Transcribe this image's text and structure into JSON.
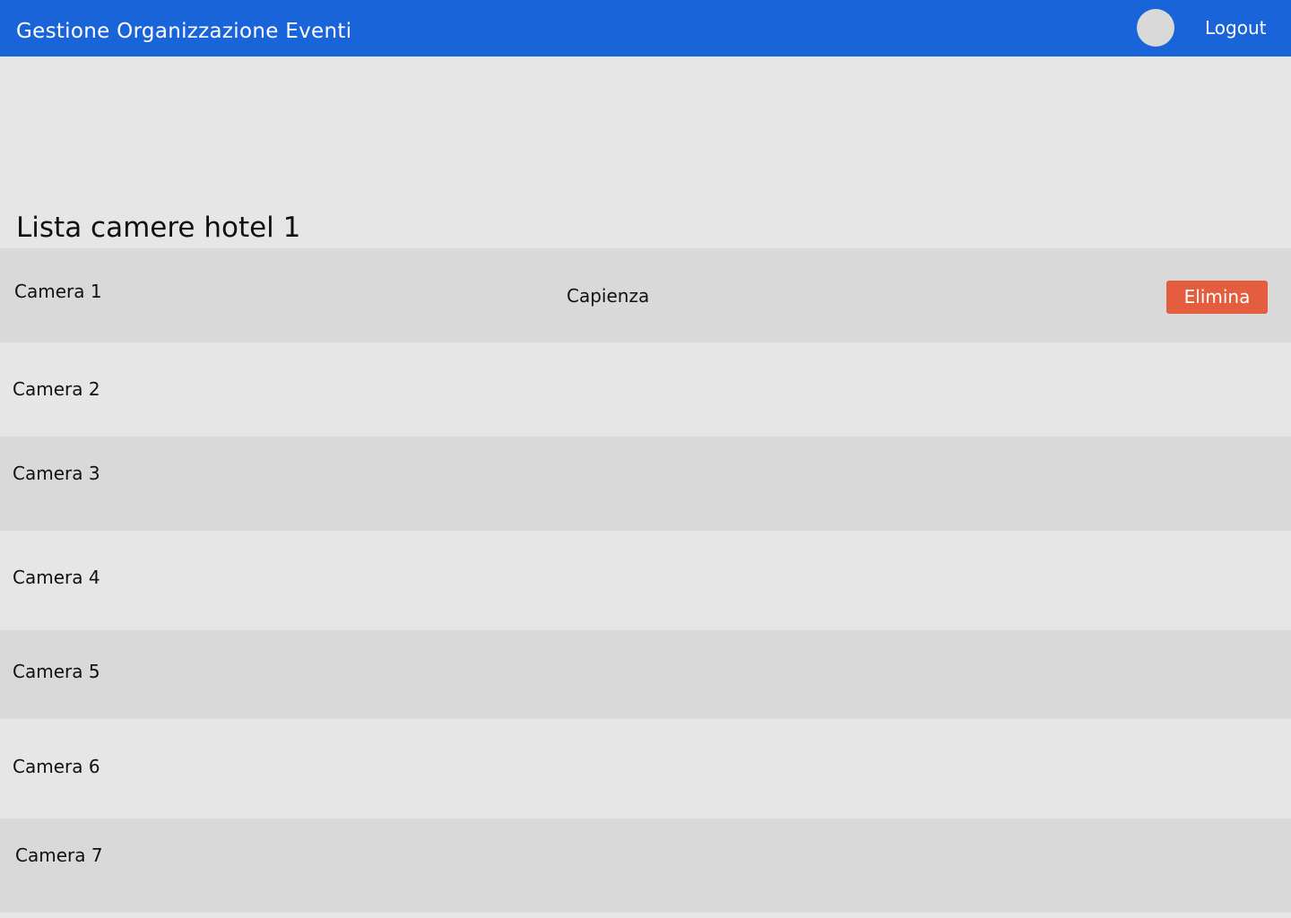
{
  "header": {
    "app_title": "Gestione Organizzazione Eventi",
    "logout_label": "Logout",
    "avatar_icon": "user-avatar",
    "background_color": "#1a64d9"
  },
  "page": {
    "title": "Lista camere hotel 1"
  },
  "rooms": [
    {
      "name": "Camera 1",
      "capacity_label": "Capienza",
      "delete_label": "Elimina"
    },
    {
      "name": "Camera 2"
    },
    {
      "name": "Camera 3"
    },
    {
      "name": "Camera 4"
    },
    {
      "name": "Camera 5"
    },
    {
      "name": "Camera 6"
    },
    {
      "name": "Camera 7"
    }
  ],
  "colors": {
    "accent": "#1a64d9",
    "danger": "#e55d3f",
    "row_dark": "#d9d9d9",
    "row_light": "#e6e6e6"
  }
}
